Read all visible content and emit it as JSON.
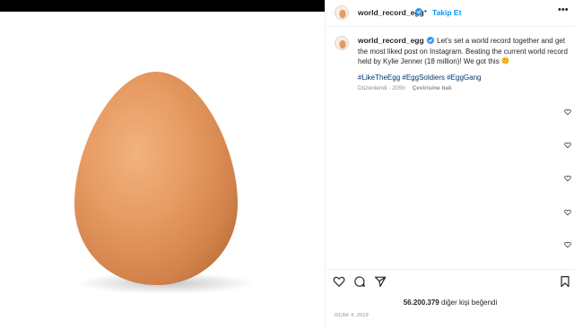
{
  "post": {
    "author": "world_record_egg",
    "follow_label": "Takip Et",
    "separator": "•",
    "more_label": "•••",
    "caption_text": "Let's set a world record together and get the most liked post on Instagram. Beating the current world record held by Kylie Jenner (18 million)! We got this",
    "hashtags": [
      "#LikeTheEgg",
      "#EggSoldiers",
      "#EggGang"
    ],
    "meta_edited": "Düzenlendi · 205h",
    "meta_translate": "Çevirisine bak",
    "likes_count": "56.200.379",
    "likes_suffix": "diğer kişi beğendi",
    "date": "Ocak 4, 2019"
  },
  "icons": {
    "verified": "verified-badge-icon",
    "emoji": "hands-over-mouth-emoji",
    "like": "heart-icon",
    "comment": "comment-icon",
    "share": "send-icon",
    "save": "bookmark-icon"
  },
  "colors": {
    "link_blue": "#0095f6",
    "hashtag_blue": "#00376b",
    "muted": "#8e8e8e",
    "egg": "#e49a62"
  }
}
